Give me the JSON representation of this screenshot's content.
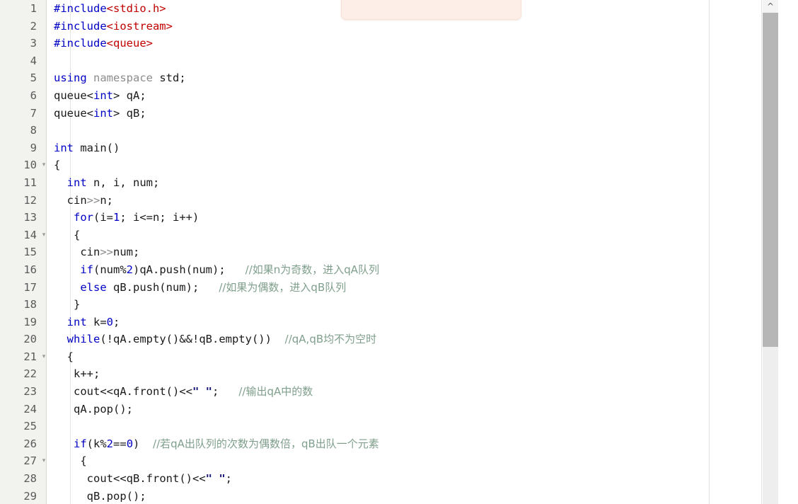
{
  "app": {
    "type": "code-editor",
    "language": "C++",
    "colors": {
      "background": "#ffffff",
      "gutter_background": "#f2f2ef",
      "line_number": "#5a5a5a",
      "keyword": "#0000c4",
      "header": "#c00000",
      "namespace": "#8c8c8c",
      "string": "#16167a",
      "comment": "#7f9f8c",
      "plain_text": "#1a1a1a",
      "scrollbar_thumb": "#b6b6b6",
      "popup_background": "#fdeee7"
    }
  },
  "scrollbar": {
    "up_arrow": "chevron-up-icon",
    "thumb_position_percent": 3,
    "thumb_size_percent": 66
  },
  "fold_marker_glyph": "▾",
  "editor": {
    "first_visible_line": 1,
    "last_visible_line": 29,
    "lines": [
      {
        "n": "1",
        "fold": "",
        "tokens": [
          {
            "t": "#include",
            "c": "kb"
          },
          {
            "t": "<stdio.h>",
            "c": "hdr"
          }
        ]
      },
      {
        "n": "2",
        "fold": "",
        "tokens": [
          {
            "t": "#include",
            "c": "kb"
          },
          {
            "t": "<iostream>",
            "c": "hdr"
          }
        ]
      },
      {
        "n": "3",
        "fold": "",
        "tokens": [
          {
            "t": "#include",
            "c": "kb"
          },
          {
            "t": "<queue>",
            "c": "hdr"
          }
        ]
      },
      {
        "n": "4",
        "fold": "",
        "tokens": []
      },
      {
        "n": "5",
        "fold": "",
        "tokens": [
          {
            "t": "using",
            "c": "k"
          },
          {
            "t": " ",
            "c": "pl"
          },
          {
            "t": "namespace",
            "c": "ns"
          },
          {
            "t": " std;",
            "c": "pl"
          }
        ]
      },
      {
        "n": "6",
        "fold": "",
        "tokens": [
          {
            "t": "queue",
            "c": "pl"
          },
          {
            "t": "<",
            "c": "pl"
          },
          {
            "t": "int",
            "c": "k"
          },
          {
            "t": "> qA;",
            "c": "pl"
          }
        ]
      },
      {
        "n": "7",
        "fold": "",
        "tokens": [
          {
            "t": "queue",
            "c": "pl"
          },
          {
            "t": "<",
            "c": "pl"
          },
          {
            "t": "int",
            "c": "k"
          },
          {
            "t": "> qB;",
            "c": "pl"
          }
        ]
      },
      {
        "n": "8",
        "fold": "",
        "tokens": []
      },
      {
        "n": "9",
        "fold": "",
        "tokens": [
          {
            "t": "int",
            "c": "k"
          },
          {
            "t": " main()",
            "c": "pl"
          }
        ]
      },
      {
        "n": "10",
        "fold": "▾",
        "tokens": [
          {
            "t": "{",
            "c": "pl"
          }
        ]
      },
      {
        "n": "11",
        "fold": "",
        "tokens": [
          {
            "t": "  ",
            "c": "pl"
          },
          {
            "t": "int",
            "c": "k"
          },
          {
            "t": " n, i, num;",
            "c": "pl"
          }
        ]
      },
      {
        "n": "12",
        "fold": "",
        "tokens": [
          {
            "t": "  cin",
            "c": "pl"
          },
          {
            "t": ">>",
            "c": "ns"
          },
          {
            "t": "n;",
            "c": "pl"
          }
        ]
      },
      {
        "n": "13",
        "fold": "",
        "tokens": [
          {
            "t": "   ",
            "c": "pl"
          },
          {
            "t": "for",
            "c": "k"
          },
          {
            "t": "(i=",
            "c": "pl"
          },
          {
            "t": "1",
            "c": "num"
          },
          {
            "t": "; i",
            "c": "pl"
          },
          {
            "t": "<=",
            "c": "pl"
          },
          {
            "t": "n; i++)",
            "c": "pl"
          }
        ]
      },
      {
        "n": "14",
        "fold": "▾",
        "tokens": [
          {
            "t": "   {",
            "c": "pl"
          }
        ]
      },
      {
        "n": "15",
        "fold": "",
        "tokens": [
          {
            "t": "    cin",
            "c": "pl"
          },
          {
            "t": ">>",
            "c": "ns"
          },
          {
            "t": "num;",
            "c": "pl"
          }
        ]
      },
      {
        "n": "16",
        "fold": "",
        "tokens": [
          {
            "t": "    ",
            "c": "pl"
          },
          {
            "t": "if",
            "c": "k"
          },
          {
            "t": "(num%",
            "c": "pl"
          },
          {
            "t": "2",
            "c": "num"
          },
          {
            "t": ")qA.push(num);",
            "c": "pl"
          },
          {
            "t": "   ",
            "c": "pl"
          },
          {
            "t": "//如果n为奇数，进入qA队列",
            "c": "cmt"
          }
        ]
      },
      {
        "n": "17",
        "fold": "",
        "tokens": [
          {
            "t": "    ",
            "c": "pl"
          },
          {
            "t": "else",
            "c": "k"
          },
          {
            "t": " qB.push(num);",
            "c": "pl"
          },
          {
            "t": "   ",
            "c": "pl"
          },
          {
            "t": "//如果为偶数，进入qB队列",
            "c": "cmt"
          }
        ]
      },
      {
        "n": "18",
        "fold": "",
        "tokens": [
          {
            "t": "   }",
            "c": "pl"
          }
        ]
      },
      {
        "n": "19",
        "fold": "",
        "tokens": [
          {
            "t": "  ",
            "c": "pl"
          },
          {
            "t": "int",
            "c": "k"
          },
          {
            "t": " k=",
            "c": "pl"
          },
          {
            "t": "0",
            "c": "num"
          },
          {
            "t": ";",
            "c": "pl"
          }
        ]
      },
      {
        "n": "20",
        "fold": "",
        "tokens": [
          {
            "t": "  ",
            "c": "pl"
          },
          {
            "t": "while",
            "c": "k"
          },
          {
            "t": "(!qA.empty()&&!qB.empty())",
            "c": "pl"
          },
          {
            "t": "  ",
            "c": "pl"
          },
          {
            "t": "//qA,qB均不为空时",
            "c": "cmt"
          }
        ]
      },
      {
        "n": "21",
        "fold": "▾",
        "tokens": [
          {
            "t": "  {",
            "c": "pl"
          }
        ]
      },
      {
        "n": "22",
        "fold": "",
        "tokens": [
          {
            "t": "   k++;",
            "c": "pl"
          }
        ]
      },
      {
        "n": "23",
        "fold": "",
        "tokens": [
          {
            "t": "   cout",
            "c": "pl"
          },
          {
            "t": "<<",
            "c": "pl"
          },
          {
            "t": "qA.front()",
            "c": "pl"
          },
          {
            "t": "<<",
            "c": "pl"
          },
          {
            "t": "\" \"",
            "c": "str"
          },
          {
            "t": ";",
            "c": "pl"
          },
          {
            "t": "   ",
            "c": "pl"
          },
          {
            "t": "//输出qA中的数",
            "c": "cmt"
          }
        ]
      },
      {
        "n": "24",
        "fold": "",
        "tokens": [
          {
            "t": "   qA.pop();",
            "c": "pl"
          }
        ]
      },
      {
        "n": "25",
        "fold": "",
        "tokens": []
      },
      {
        "n": "26",
        "fold": "",
        "tokens": [
          {
            "t": "   ",
            "c": "pl"
          },
          {
            "t": "if",
            "c": "k"
          },
          {
            "t": "(k%",
            "c": "pl"
          },
          {
            "t": "2",
            "c": "num"
          },
          {
            "t": "==",
            "c": "pl"
          },
          {
            "t": "0",
            "c": "num"
          },
          {
            "t": ")",
            "c": "pl"
          },
          {
            "t": "  ",
            "c": "pl"
          },
          {
            "t": "//若qA出队列的次数为偶数倍，qB出队一个元素",
            "c": "cmt"
          }
        ]
      },
      {
        "n": "27",
        "fold": "▾",
        "tokens": [
          {
            "t": "    {",
            "c": "pl"
          }
        ]
      },
      {
        "n": "28",
        "fold": "",
        "tokens": [
          {
            "t": "     cout",
            "c": "pl"
          },
          {
            "t": "<<",
            "c": "pl"
          },
          {
            "t": "qB.front()",
            "c": "pl"
          },
          {
            "t": "<<",
            "c": "pl"
          },
          {
            "t": "\" \"",
            "c": "str"
          },
          {
            "t": ";",
            "c": "pl"
          }
        ]
      },
      {
        "n": "29",
        "fold": "",
        "tokens": [
          {
            "t": "     qB.pop();",
            "c": "pl"
          }
        ]
      }
    ]
  }
}
